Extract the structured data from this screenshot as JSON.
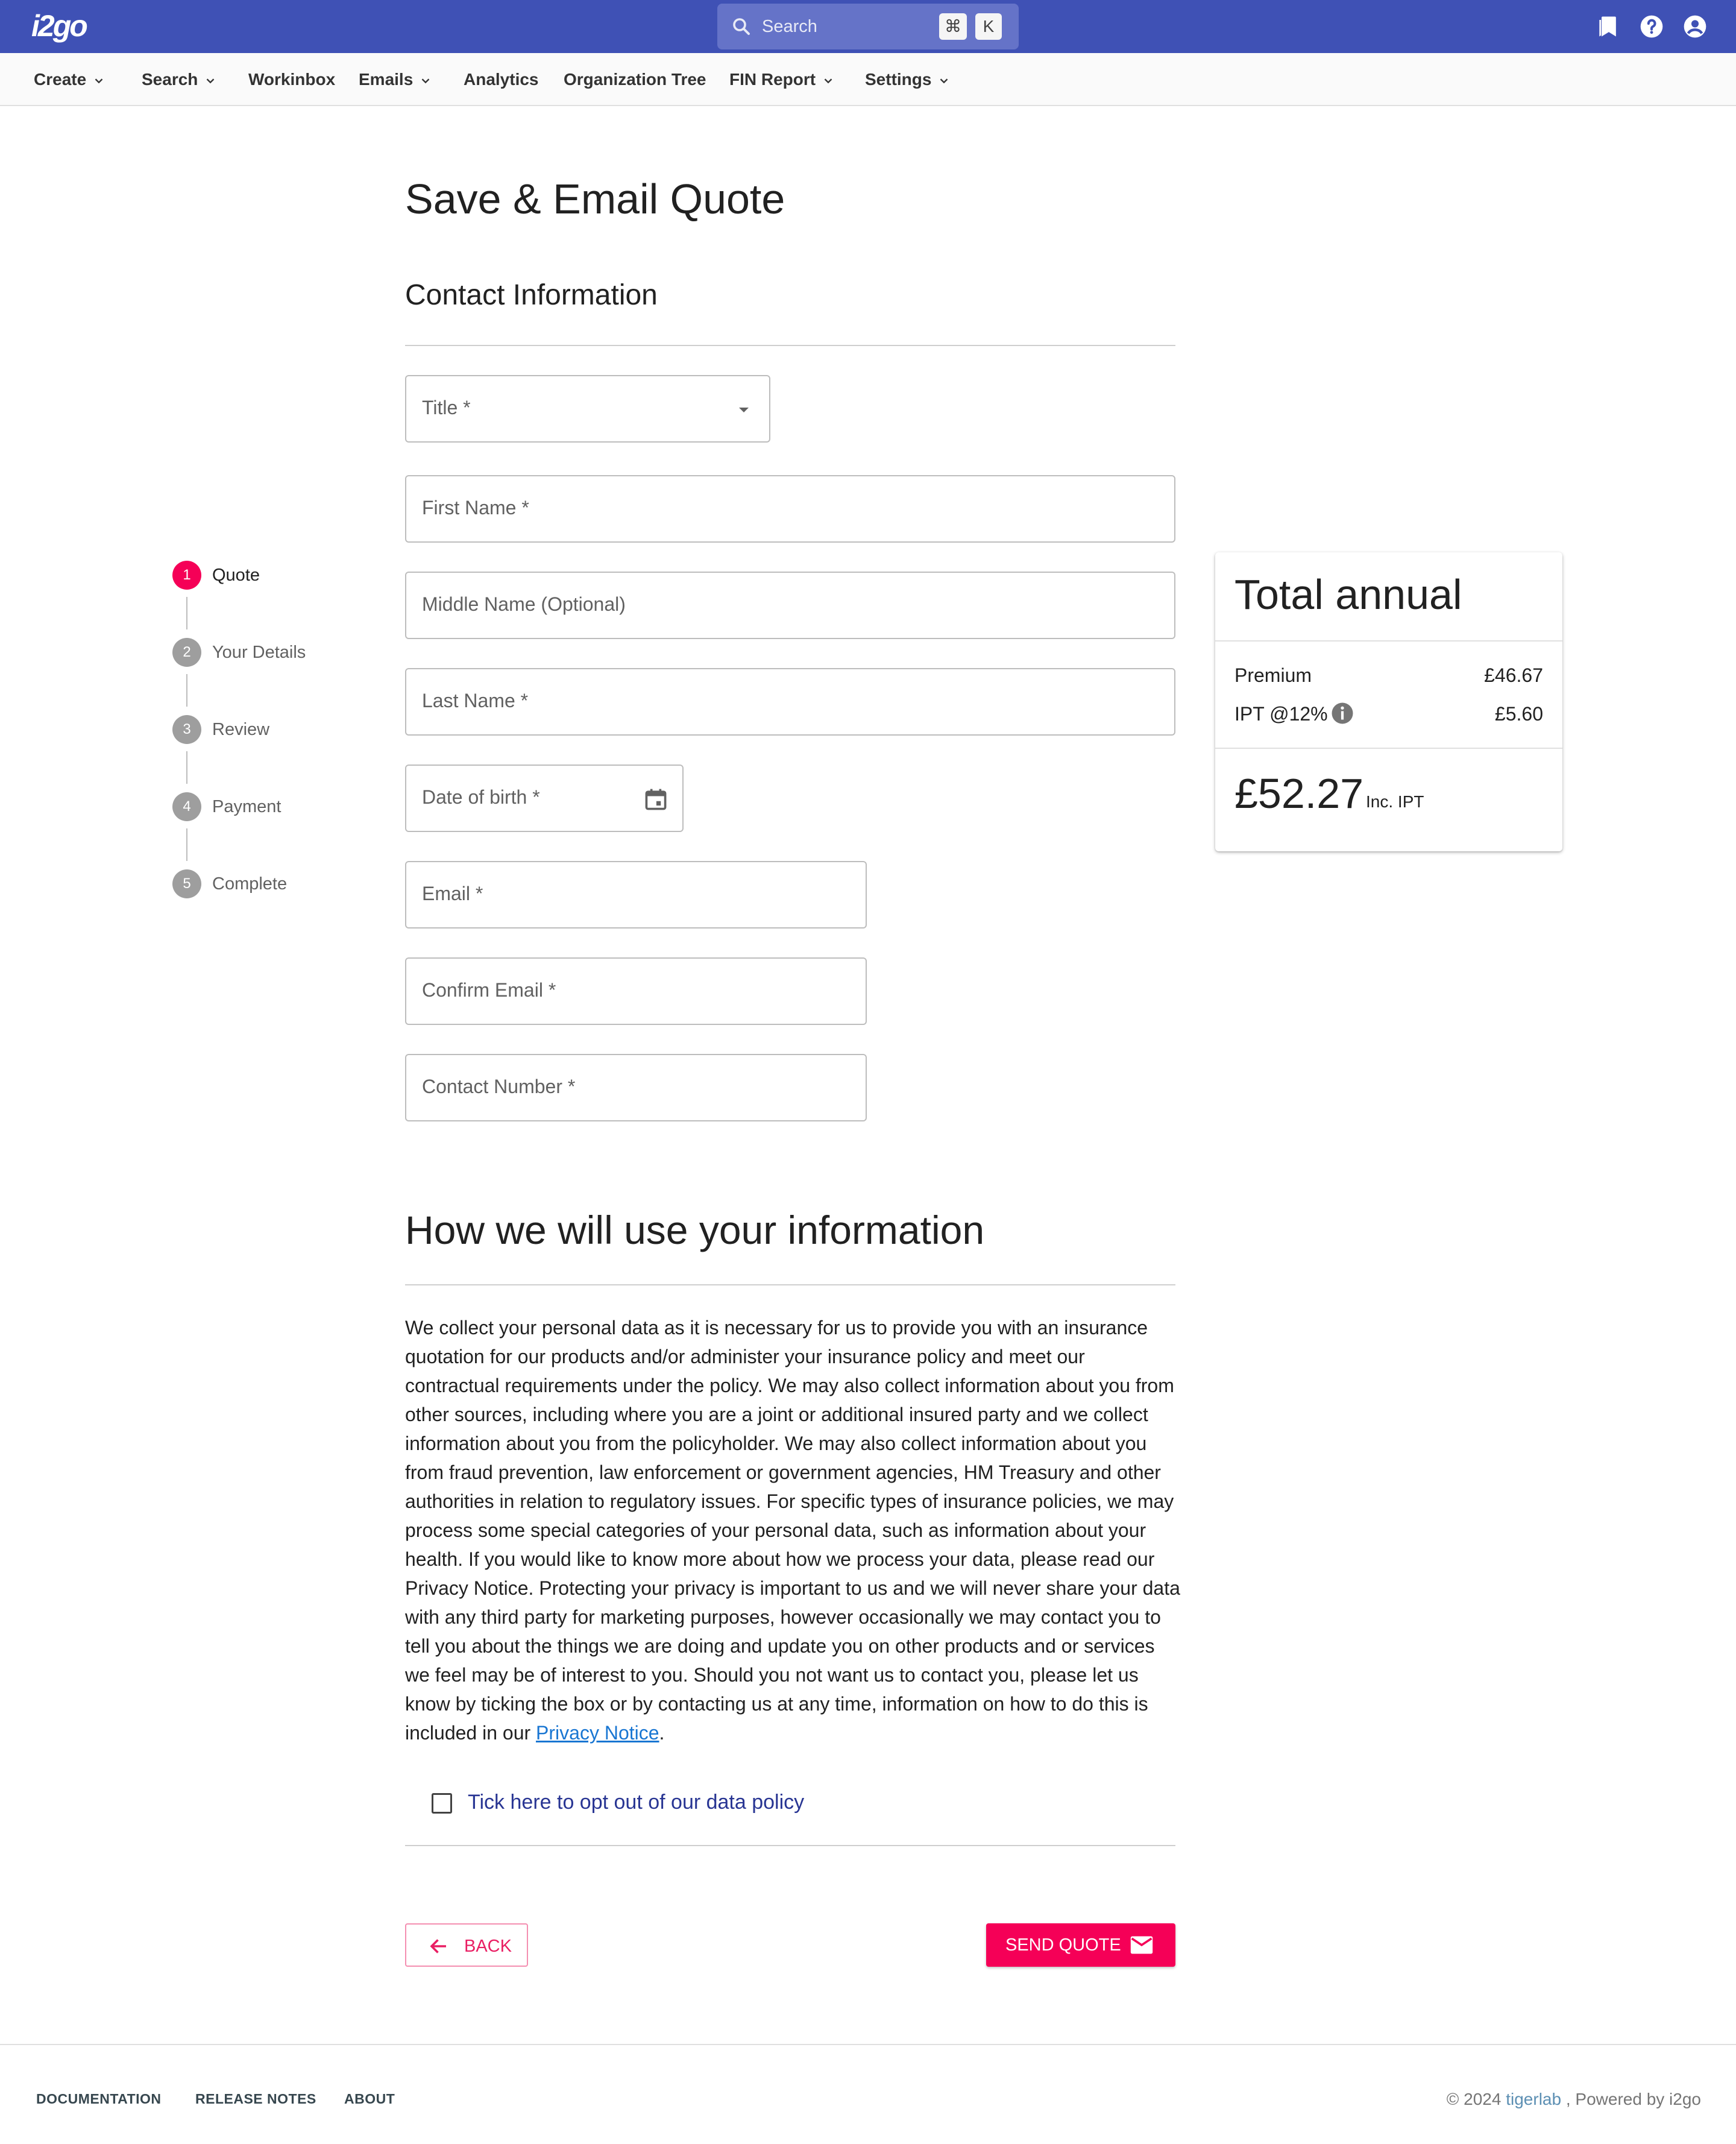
{
  "app": {
    "logo": "i2go"
  },
  "topbar": {
    "search_label": "Search",
    "shortcut_cmd": "⌘",
    "shortcut_key": "K"
  },
  "nav": {
    "items": [
      {
        "label": "Create",
        "dropdown": true
      },
      {
        "label": "Search",
        "dropdown": true
      },
      {
        "label": "Workinbox",
        "dropdown": false
      },
      {
        "label": "Emails",
        "dropdown": true
      },
      {
        "label": "Analytics",
        "dropdown": false
      },
      {
        "label": "Organization Tree",
        "dropdown": false
      },
      {
        "label": "FIN Report",
        "dropdown": true
      },
      {
        "label": "Settings",
        "dropdown": true
      }
    ]
  },
  "page": {
    "title": "Save & Email Quote",
    "contact_heading": "Contact Information"
  },
  "form": {
    "title_label": "Title *",
    "first_name_label": "First Name  *",
    "middle_name_label": "Middle Name (Optional)",
    "last_name_label": "Last Name  *",
    "dob_label": "Date of birth *",
    "email_label": "Email  *",
    "confirm_email_label": "Confirm Email  *",
    "contact_number_label": "Contact Number  *"
  },
  "stepper": {
    "steps": [
      {
        "num": "1",
        "label": "Quote",
        "active": true
      },
      {
        "num": "2",
        "label": "Your Details",
        "active": false
      },
      {
        "num": "3",
        "label": "Review",
        "active": false
      },
      {
        "num": "4",
        "label": "Payment",
        "active": false
      },
      {
        "num": "5",
        "label": "Complete",
        "active": false
      }
    ]
  },
  "summary": {
    "title": "Total annual",
    "premium_label": "Premium",
    "premium_value": "£46.67",
    "ipt_label": "IPT @12%",
    "ipt_value": "£5.60",
    "total": "£52.27",
    "total_suffix": "Inc. IPT"
  },
  "info": {
    "heading": "How we will use your information",
    "body": "We collect your personal data as it is necessary for us to provide you with an insurance quotation for our products and/or administer your insurance policy and meet our contractual requirements under the policy. We may also collect information about you from other sources, including where you are a joint or additional insured party and we collect information about you from the policyholder. We may also collect information about you from fraud prevention, law enforcement or government agencies, HM Treasury and other authorities in relation to regulatory issues. For specific types of insurance policies, we may process some special categories of your personal data, such as information about your health. If you would like to know more about how we process your data, please read our Privacy Notice. Protecting your privacy is important to us and we will never share your data with any third party for marketing purposes, however occasionally we may contact you to tell you about the things we are doing and update you on other products and or services we feel may be of interest to you. Should you not want us to contact you, please let us know by ticking the box or by contacting us at any time, information on how to do this is included in our ",
    "link": "Privacy Notice",
    "body_end": ".",
    "optout_label": "Tick here to opt out of our data policy"
  },
  "actions": {
    "back": "BACK",
    "send": "SEND QUOTE"
  },
  "footer": {
    "links": [
      "DOCUMENTATION",
      "RELEASE NOTES",
      "ABOUT"
    ],
    "copyright": "© 2024 ",
    "brand": "tigerlab",
    "powered": " , Powered by i2go"
  },
  "colors": {
    "primary": "#3f51b5",
    "accent": "#f50057",
    "step_inactive": "#9e9e9e"
  }
}
